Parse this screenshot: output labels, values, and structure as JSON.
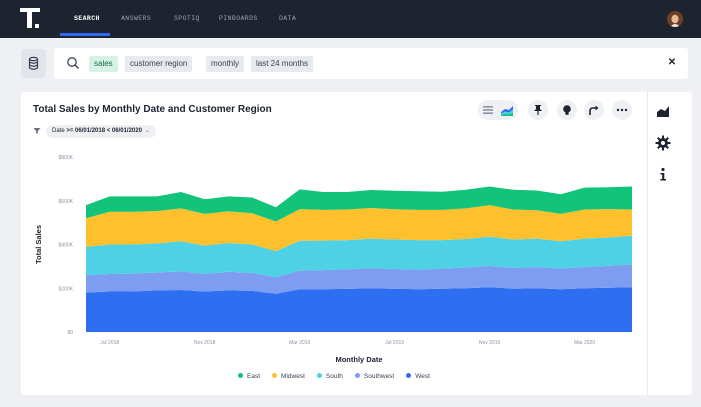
{
  "nav": {
    "logo_icon": "thoughtspot-logo-icon",
    "items": [
      "SEARCH",
      "ANSWERS",
      "SPOTIQ",
      "PINBOARDS",
      "DATA"
    ],
    "active_index": 0,
    "avatar_icon": "user-avatar-icon"
  },
  "search": {
    "data_button_icon": "database-icon",
    "search_icon": "search-icon",
    "tokens": [
      "sales",
      "customer region",
      "monthly",
      "last 24 months"
    ],
    "clear_icon": "close-icon"
  },
  "answer": {
    "title": "Total Sales by Monthly Date and Customer Region",
    "filter_prefix": "Date ",
    "filter_value": ">= 06/01/2018 < 06/01/2020",
    "toolbar_icons": [
      "table-view-icon",
      "chart-view-icon",
      "pin-icon",
      "insight-bulb-icon",
      "share-icon",
      "more-icon"
    ],
    "side_icons": [
      "chart-type-icon",
      "settings-gear-icon",
      "info-icon"
    ]
  },
  "colors": {
    "nav_bg": "#1d232f",
    "accent": "#2f6bf0",
    "East": "#12c37a",
    "Midwest": "#ffc02e",
    "South": "#4fd1e5",
    "Southwest": "#7c9df0",
    "West": "#2e6ff2"
  },
  "chart_data": {
    "type": "area",
    "stacked": true,
    "title": "Total Sales by Monthly Date and Customer Region",
    "xlabel": "Monthly Date",
    "ylabel": "Total Sales",
    "ylim": [
      0,
      800000
    ],
    "y_ticks": [
      "$0",
      "$200K",
      "$400K",
      "$600K",
      "$800K"
    ],
    "x_ticks": [
      "Jul 2018",
      "Nov 2018",
      "Mar 2019",
      "Jul 2019",
      "Nov 2019",
      "Mar 2020"
    ],
    "x_tick_index": [
      1,
      5,
      9,
      13,
      17,
      21
    ],
    "legend_position": "bottom",
    "series": [
      {
        "name": "West",
        "values": [
          180000,
          185000,
          185000,
          190000,
          192000,
          185000,
          190000,
          188000,
          175000,
          195000,
          195000,
          197000,
          200000,
          198000,
          195000,
          198000,
          200000,
          205000,
          198000,
          200000,
          195000,
          200000,
          202000,
          205000
        ]
      },
      {
        "name": "Southwest",
        "values": [
          80000,
          80000,
          82000,
          82000,
          85000,
          80000,
          85000,
          82000,
          75000,
          85000,
          88000,
          90000,
          92000,
          90000,
          90000,
          92000,
          95000,
          97000,
          95000,
          97000,
          95000,
          97000,
          100000,
          105000
        ]
      },
      {
        "name": "South",
        "values": [
          130000,
          135000,
          133000,
          133000,
          138000,
          130000,
          132000,
          130000,
          120000,
          137000,
          135000,
          133000,
          135000,
          135000,
          135000,
          130000,
          130000,
          133000,
          130000,
          130000,
          125000,
          130000,
          130000,
          130000
        ]
      },
      {
        "name": "Midwest",
        "values": [
          130000,
          150000,
          150000,
          148000,
          150000,
          145000,
          145000,
          143000,
          135000,
          145000,
          140000,
          140000,
          140000,
          138000,
          138000,
          138000,
          140000,
          145000,
          137000,
          130000,
          125000,
          133000,
          130000,
          120000
        ]
      },
      {
        "name": "East",
        "values": [
          60000,
          70000,
          70000,
          67000,
          75000,
          67000,
          68000,
          72000,
          65000,
          90000,
          82000,
          80000,
          82000,
          85000,
          85000,
          83000,
          85000,
          85000,
          90000,
          90000,
          90000,
          100000,
          100000,
          105000
        ]
      }
    ]
  }
}
